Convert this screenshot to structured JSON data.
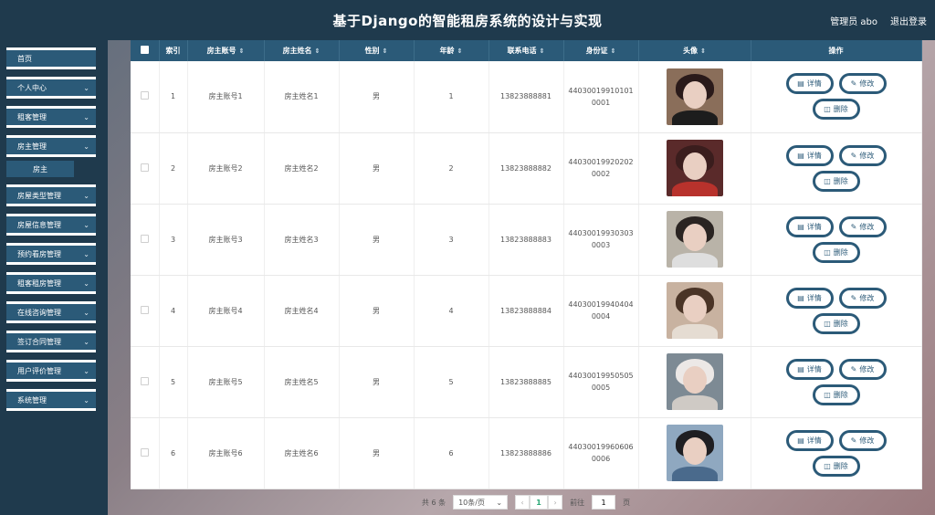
{
  "header": {
    "title": "基于Django的智能租房系统的设计与实现",
    "user_label": "管理员 abo",
    "logout_label": "退出登录"
  },
  "sidebar": {
    "items": [
      {
        "label": "首页",
        "has_chevron": false
      },
      {
        "label": "个人中心",
        "has_chevron": true
      },
      {
        "label": "租客管理",
        "has_chevron": true
      },
      {
        "label": "房主管理",
        "has_chevron": true,
        "expanded": true
      },
      {
        "label": "房屋类型管理",
        "has_chevron": true
      },
      {
        "label": "房屋信息管理",
        "has_chevron": true
      },
      {
        "label": "预约看房管理",
        "has_chevron": true
      },
      {
        "label": "租客租房管理",
        "has_chevron": true
      },
      {
        "label": "在线咨询管理",
        "has_chevron": true
      },
      {
        "label": "签订合同管理",
        "has_chevron": true
      },
      {
        "label": "用户评价管理",
        "has_chevron": true
      },
      {
        "label": "系统管理",
        "has_chevron": true
      }
    ],
    "submenu_label": "房主"
  },
  "table": {
    "columns": [
      "索引",
      "房主账号",
      "房主姓名",
      "性别",
      "年龄",
      "联系电话",
      "身份证",
      "头像",
      "操作"
    ],
    "rows": [
      {
        "index": "1",
        "account": "房主账号1",
        "name": "房主姓名1",
        "gender": "男",
        "age": "1",
        "phone": "13823888881",
        "id_line1": "44030019910101",
        "id_line2": "0001"
      },
      {
        "index": "2",
        "account": "房主账号2",
        "name": "房主姓名2",
        "gender": "男",
        "age": "2",
        "phone": "13823888882",
        "id_line1": "44030019920202",
        "id_line2": "0002"
      },
      {
        "index": "3",
        "account": "房主账号3",
        "name": "房主姓名3",
        "gender": "男",
        "age": "3",
        "phone": "13823888883",
        "id_line1": "44030019930303",
        "id_line2": "0003"
      },
      {
        "index": "4",
        "account": "房主账号4",
        "name": "房主姓名4",
        "gender": "男",
        "age": "4",
        "phone": "13823888884",
        "id_line1": "44030019940404",
        "id_line2": "0004"
      },
      {
        "index": "5",
        "account": "房主账号5",
        "name": "房主姓名5",
        "gender": "男",
        "age": "5",
        "phone": "13823888885",
        "id_line1": "44030019950505",
        "id_line2": "0005"
      },
      {
        "index": "6",
        "account": "房主账号6",
        "name": "房主姓名6",
        "gender": "男",
        "age": "6",
        "phone": "13823888886",
        "id_line1": "44030019960606",
        "id_line2": "0006"
      }
    ],
    "actions": {
      "detail": "详情",
      "edit": "修改",
      "delete": "删除"
    }
  },
  "pager": {
    "total_text": "共 6 条",
    "page_size": "10条/页",
    "current_page": "1",
    "goto_label": "前往",
    "goto_value": "1",
    "page_suffix": "页"
  },
  "colors": {
    "header_bg": "#1f3a4d",
    "accent": "#2b5a78",
    "current_page": "#2aa876"
  }
}
